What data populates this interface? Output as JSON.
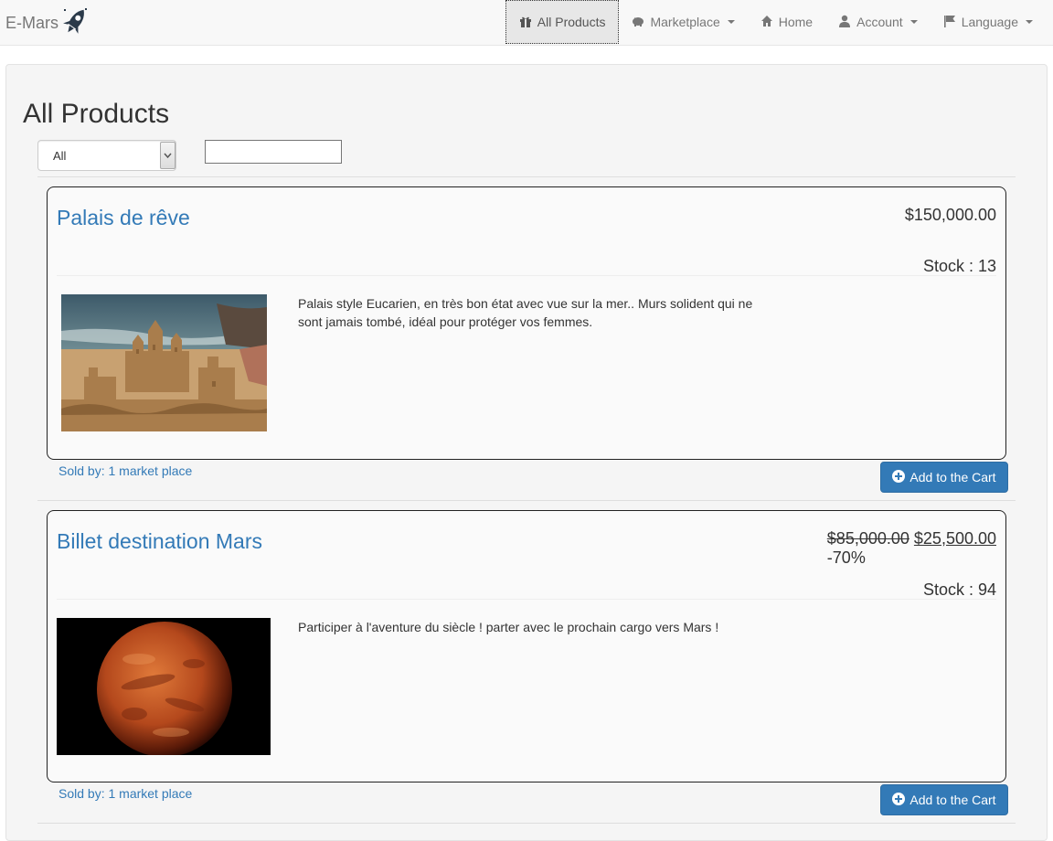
{
  "brand": {
    "name": "E-Mars",
    "logo_icon": "rocket-icon"
  },
  "nav": {
    "items": [
      {
        "label": "All Products",
        "icon": "gift-icon",
        "dropdown": false,
        "active": true
      },
      {
        "label": "Marketplace",
        "icon": "piggy-bank-icon",
        "dropdown": true,
        "active": false
      },
      {
        "label": "Home",
        "icon": "home-icon",
        "dropdown": false,
        "active": false
      },
      {
        "label": "Account",
        "icon": "user-icon",
        "dropdown": true,
        "active": false
      },
      {
        "label": "Language",
        "icon": "flag-icon",
        "dropdown": true,
        "active": false
      }
    ]
  },
  "page": {
    "title": "All Products",
    "filter": {
      "selected": "All",
      "options": [
        "All"
      ]
    },
    "search": {
      "value": "",
      "placeholder": ""
    }
  },
  "products": [
    {
      "title": "Palais de rêve",
      "price": "$150,000.00",
      "old_price": "",
      "discount": "",
      "stock": "Stock : 13",
      "description": "Palais style Eucarien, en très bon état avec vue sur la mer.. Murs solident qui ne sont jamais tombé, idéal pour protéger vos femmes.",
      "image": "sand-castle-image",
      "sold_by": "Sold by: 1 market place",
      "cart_label": "Add to the Cart"
    },
    {
      "title": "Billet destination Mars",
      "price": "$25,500.00",
      "old_price": "$85,000.00",
      "discount": "-70%",
      "stock": "Stock : 94",
      "description": "Participer à l'aventure du siècle ! parter avec le prochain cargo vers Mars !",
      "image": "mars-planet-image",
      "sold_by": "Sold by: 1 market place",
      "cart_label": "Add to the Cart"
    }
  ],
  "colors": {
    "link": "#337ab7",
    "button": "#337ab7",
    "navbar_bg": "#f8f8f8",
    "well_bg": "#f5f5f5"
  }
}
